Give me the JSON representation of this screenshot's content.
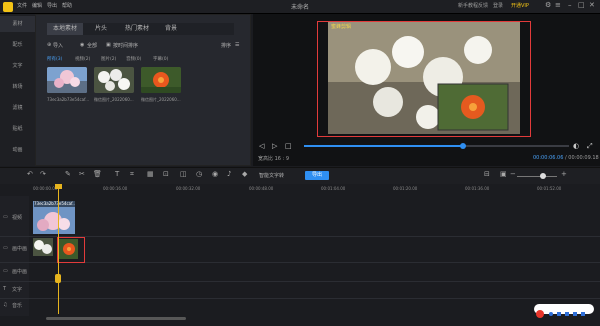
{
  "app": {
    "title": "未命名"
  },
  "titlebar": {
    "menus": [
      "文件",
      "编辑",
      "导出",
      "帮助"
    ],
    "right": [
      "新手教程",
      "反馈",
      "登录",
      "在线客服"
    ],
    "vip": "开通VIP"
  },
  "nav": [
    "素材",
    "配乐",
    "文字",
    "转场",
    "滤镜",
    "贴纸",
    "动画"
  ],
  "media": {
    "tabs": [
      "本地素材",
      "片头",
      "热门素材",
      "背景"
    ],
    "import": "导入",
    "all": "全部",
    "filter": "按时间排序",
    "sort": "排序",
    "subtabs": [
      "所有(3)",
      "视频(2)",
      "图片(2)",
      "音频(0)",
      "字幕(0)"
    ],
    "thumbs": [
      {
        "name": "73ec3a2b73e54caf...",
        "icon": "flower-thumb-1"
      },
      {
        "name": "微信图片_2022060...",
        "icon": "flower-thumb-2"
      },
      {
        "name": "微信图片_2022060...",
        "icon": "flower-thumb-3"
      }
    ]
  },
  "player": {
    "watermark": "蜜蜂剪辑",
    "ratio_label": "宽高比 16 : 9",
    "time_current": "00:00:06.06",
    "time_total": "00:00:09.18",
    "progress": 0.6
  },
  "toolbar": {
    "gen_label": "智能文字转",
    "export_label": "导出"
  },
  "ruler": [
    "00:00:00.00",
    "00:00:16.00",
    "00:00:32.00",
    "00:00:48.00",
    "00:01:04.00",
    "00:01:20.00",
    "00:01:36.00",
    "00:01:52.00"
  ],
  "tracks": [
    {
      "label": "视频",
      "icon": "video-track-icon"
    },
    {
      "label": "画中画",
      "icon": "pip-track-icon"
    },
    {
      "label": "画中画",
      "icon": "pip2-track-icon"
    },
    {
      "label": "文字",
      "icon": "text-track-icon"
    },
    {
      "label": "音乐",
      "icon": "music-track-icon"
    }
  ],
  "clip_name": "73ec3a2b73e54caf..."
}
